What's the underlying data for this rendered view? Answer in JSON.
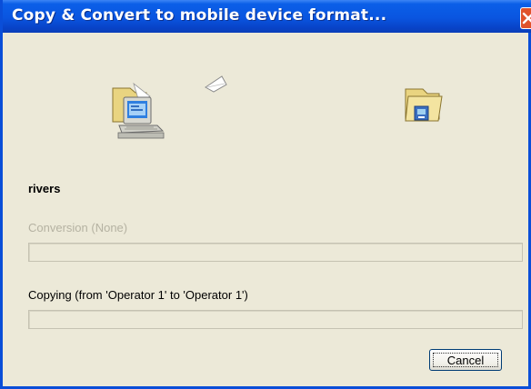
{
  "window": {
    "title": "Copy & Convert to mobile device format..."
  },
  "icons": {
    "source": "computer-with-folder-icon",
    "flying": "flying-paper-icon",
    "destination": "mobile-device-folder-icon",
    "close": "close-icon"
  },
  "file": {
    "name": "rivers"
  },
  "conversion": {
    "label": "Conversion (None)",
    "progress": 0
  },
  "copying": {
    "label": "Copying (from 'Operator 1' to 'Operator 1')",
    "progress": 0
  },
  "buttons": {
    "cancel_label": "Cancel"
  },
  "colors": {
    "titlebar": "#0a55e0",
    "close_button": "#e0522a",
    "dialog_background": "#ece9d8"
  }
}
